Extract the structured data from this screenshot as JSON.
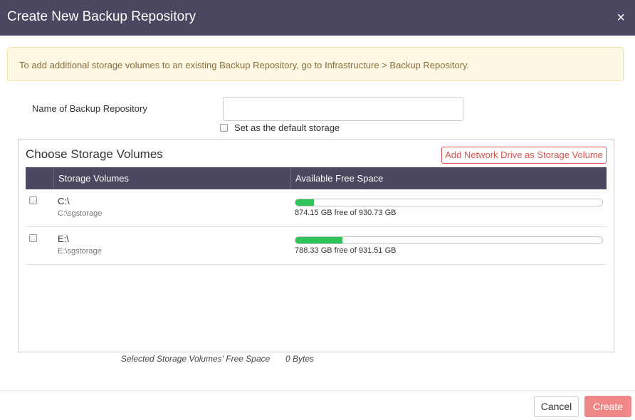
{
  "dialog": {
    "title": "Create New Backup Repository",
    "close_icon": "×"
  },
  "alert": {
    "message": "To add additional storage volumes to an existing Backup Repository, go to Infrastructure > Backup Repository."
  },
  "form": {
    "name_label": "Name of Backup Repository",
    "name_value": "",
    "default_storage_label": "Set as the default storage",
    "default_storage_checked": false
  },
  "storage": {
    "title": "Choose Storage Volumes",
    "add_button": "Add Network Drive as Storage Volume",
    "columns": [
      "Storage Volumes",
      "Available Free Space"
    ],
    "volumes": [
      {
        "name": "C:\\",
        "path": "C:\\sgstorage",
        "free_text": "874.15 GB free of 930.73 GB",
        "used_fraction": 0.061,
        "checked": false
      },
      {
        "name": "E:\\",
        "path": "E:\\sgstorage",
        "free_text": "788.33 GB free of 931.51 GB",
        "used_fraction": 0.154,
        "checked": false
      }
    ]
  },
  "summary": {
    "label": "Selected Storage Volumes' Free Space",
    "value": "0 Bytes"
  },
  "footer": {
    "cancel": "Cancel",
    "create": "Create"
  },
  "colors": {
    "header_bg": "#4b4760",
    "bar_fill": "#2fc45a",
    "accent_red": "#d9534f",
    "create_bg": "#f08888",
    "alert_bg": "#fcf8e3"
  }
}
